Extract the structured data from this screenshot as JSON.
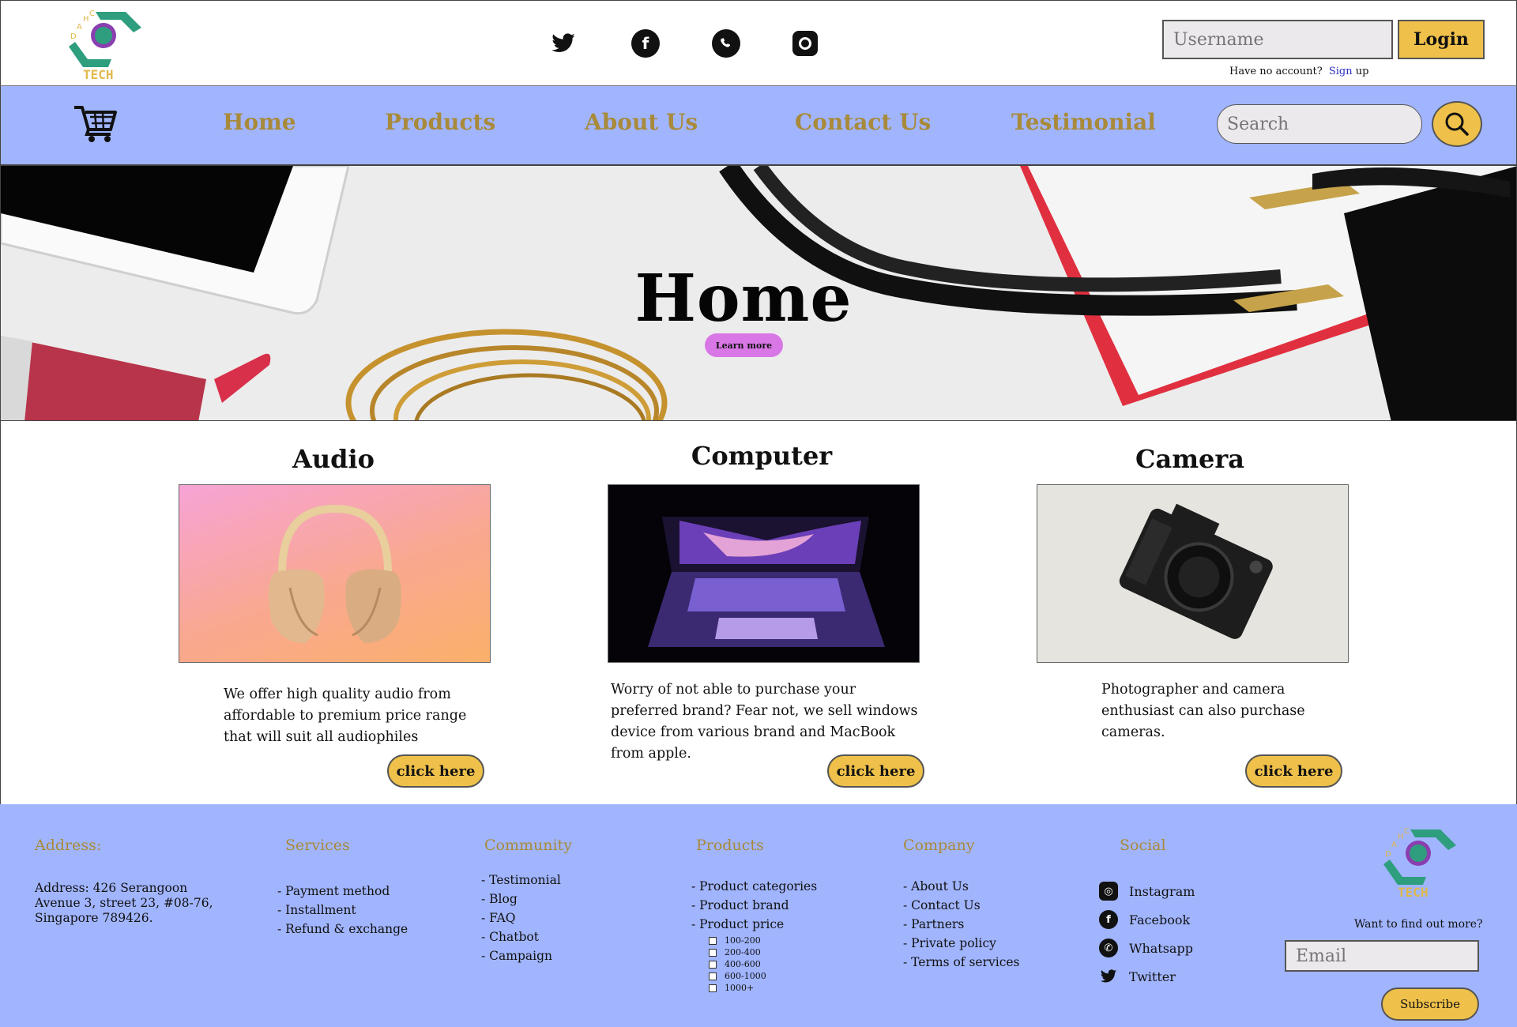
{
  "brand": {
    "logo_text": "TECH",
    "logo_letters": "DAHC"
  },
  "header": {
    "social": [
      "twitter-icon",
      "facebook-icon",
      "whatsapp-icon",
      "instagram-icon"
    ],
    "username_placeholder": "Username",
    "login_label": "Login",
    "no_account_text": "Have no account?",
    "signup_link": "Sign",
    "signup_suffix": "up"
  },
  "nav": {
    "items": [
      {
        "label": "Home"
      },
      {
        "label": "Products"
      },
      {
        "label": "About Us"
      },
      {
        "label": "Contact Us"
      },
      {
        "label": "Testimonial"
      }
    ],
    "search_placeholder": "Search"
  },
  "hero": {
    "title": "Home",
    "button": "Learn more"
  },
  "categories": [
    {
      "title": "Audio",
      "text": "We offer high quality audio from affordable to premium price range that will suit all audiophiles",
      "button": "click here"
    },
    {
      "title": "Computer",
      "text": "Worry of not able to purchase your preferred brand? Fear not, we sell windows device from various brand and MacBook from apple.",
      "button": "click here"
    },
    {
      "title": "Camera",
      "text": "Photographer and camera enthusiast can also purchase cameras.",
      "button": "click here"
    }
  ],
  "footer": {
    "address": {
      "heading": "Address:",
      "line1": "Address: 426 Serangoon",
      "line2": "Avenue 3, street 23, #08-76,",
      "line3": "Singapore 789426."
    },
    "services": {
      "heading": "Services",
      "items": [
        "- Payment method",
        "- Installment",
        "- Refund & exchange"
      ]
    },
    "community": {
      "heading": "Community",
      "items": [
        "- Testimonial",
        "- Blog",
        "- FAQ",
        "- Chatbot",
        "- Campaign"
      ]
    },
    "products": {
      "heading": "Products",
      "items": [
        "- Product categories",
        "- Product brand",
        "- Product price"
      ],
      "price_ranges": [
        "100-200",
        "200-400",
        "400-600",
        "600-1000",
        "1000+"
      ]
    },
    "company": {
      "heading": "Company",
      "items": [
        "- About Us",
        "- Contact Us",
        "- Partners",
        "- Private policy",
        "- Terms of services"
      ]
    },
    "social": {
      "heading": "Social",
      "items": [
        {
          "label": "Instagram",
          "icon": "instagram-icon"
        },
        {
          "label": "Facebook",
          "icon": "facebook-icon"
        },
        {
          "label": "Whatsapp",
          "icon": "whatsapp-icon"
        },
        {
          "label": "Twitter",
          "icon": "twitter-icon"
        }
      ]
    },
    "newsletter": {
      "prompt": "Want to find out more?",
      "email_placeholder": "Email",
      "subscribe": "Subscribe"
    }
  },
  "colors": {
    "nav_bg": "#a1b5ff",
    "accent_gold": "#efc14a",
    "nav_text": "#a88a3a",
    "hero_button": "#d977e6",
    "logo_green": "#2e9e7e",
    "logo_purple": "#8a3fb0"
  }
}
